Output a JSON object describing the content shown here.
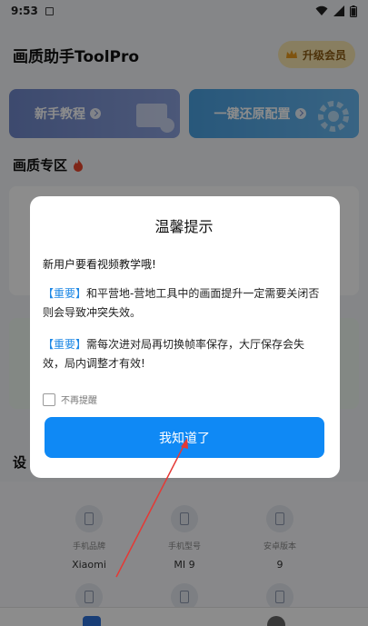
{
  "status_bar": {
    "time": "9:53"
  },
  "header": {
    "title": "画质助手ToolPro",
    "vip_label": "升级会员"
  },
  "cards": {
    "tutorial": "新手教程",
    "restore": "一键还原配置"
  },
  "sections": {
    "quality": "画质专区",
    "device_prefix": "设"
  },
  "device": [
    {
      "label": "手机品牌",
      "value": "Xiaomi"
    },
    {
      "label": "手机型号",
      "value": "MI 9"
    },
    {
      "label": "安卓版本",
      "value": "9"
    }
  ],
  "dialog": {
    "title": "温馨提示",
    "intro": "新用户要看视频教学哦!",
    "tag": "【重要】",
    "para1": "和平营地-营地工具中的画面提升一定需要关闭否则会导致冲突失效。",
    "para2": "需每次进对局再切换帧率保存，大厅保存会失效，局内调整才有效!",
    "checkbox_label": "不再提醒",
    "ok_label": "我知道了"
  },
  "colors": {
    "accent": "#0f89f5",
    "tag": "#1e88e5",
    "arrow": "#e53935"
  }
}
